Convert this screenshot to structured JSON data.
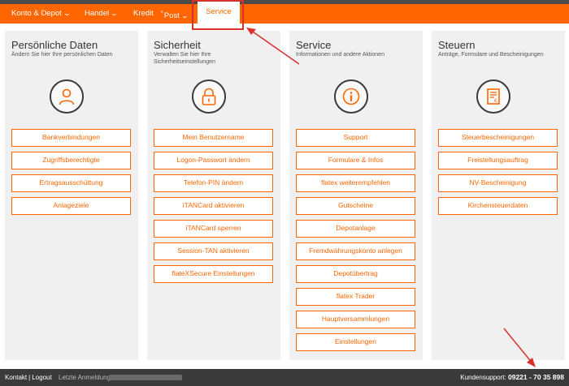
{
  "nav": {
    "items": [
      {
        "label": "Konto & Depot",
        "chevron": true
      },
      {
        "label": "Handel",
        "chevron": true
      },
      {
        "label": "Kredit",
        "chevron": false
      },
      {
        "label": "Post",
        "chevron": true,
        "star": "*"
      }
    ],
    "active": "Service"
  },
  "columns": [
    {
      "title": "Persönliche Daten",
      "subtitle": "Ändern Sie hier Ihre persönlichen Daten",
      "icon": "user-icon",
      "buttons": [
        "Bankverbindungen",
        "Zugriffsberechtigte",
        "Ertragsausschüttung",
        "Anlageziele"
      ]
    },
    {
      "title": "Sicherheit",
      "subtitle": "Verwalten Sie hier Ihre Sicherheitseinstellungen",
      "icon": "lock-icon",
      "buttons": [
        "Mein Benutzername",
        "Logon-Passwort ändern",
        "Telefon-PIN ändern",
        "iTANCard aktivieren",
        "iTANCard sperren",
        "Session-TAN aktivieren",
        "flateXSecure Einstellungen"
      ]
    },
    {
      "title": "Service",
      "subtitle": "Informationen und andere Aktionen",
      "icon": "info-icon",
      "buttons": [
        "Support",
        "Formulare & Infos",
        "flatex weiterempfehlen",
        "Gutscheine",
        "Depotanlage",
        "Fremdwährungskonto anlegen",
        "Depotübertrag",
        "flatex Trader",
        "Hauptversammlungen",
        "Einstellungen"
      ]
    },
    {
      "title": "Steuern",
      "subtitle": "Anträge, Formulare und Bescheinigungen",
      "icon": "tax-document-icon",
      "buttons": [
        "Steuerbescheinigungen",
        "Freistellungsauftrag",
        "NV-Bescheinigung",
        "Kirchensteuerdaten"
      ]
    }
  ],
  "footer": {
    "kontakt": "Kontakt",
    "separator": "|",
    "logout": "Logout",
    "last_login": "Letzte Anmeldung:",
    "support_label": "Kundensupport:",
    "support_phone": "09221 - 70 35 898"
  },
  "colors": {
    "accent": "#ff6600",
    "annotation": "#d9302a",
    "footer_bg": "#3a3a3a",
    "column_bg": "#f0f0f0"
  }
}
